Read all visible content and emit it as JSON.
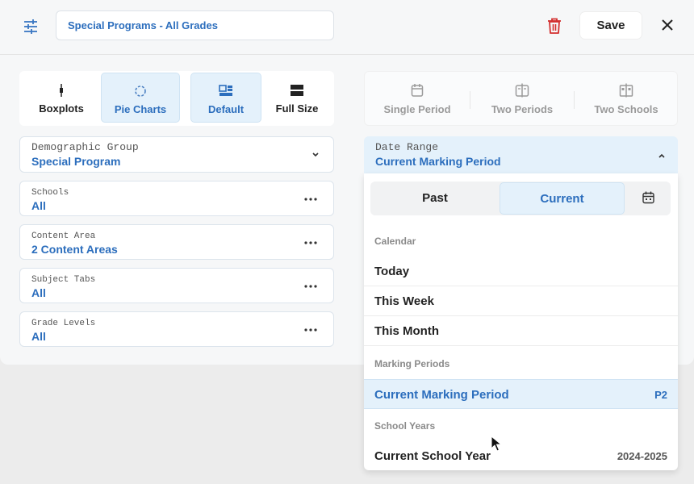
{
  "header": {
    "title_value": "Special Programs - All Grades",
    "save_label": "Save"
  },
  "viz_types": {
    "items": [
      {
        "label": "Boxplots",
        "icon": "boxplot-icon"
      },
      {
        "label": "Pie Charts",
        "icon": "pie-chart-icon"
      }
    ]
  },
  "layout_types": {
    "items": [
      {
        "label": "Default",
        "icon": "default-layout-icon"
      },
      {
        "label": "Full Size",
        "icon": "full-size-icon"
      }
    ]
  },
  "period_types": {
    "items": [
      {
        "label": "Single Period",
        "icon": "calendar-icon"
      },
      {
        "label": "Two Periods",
        "icon": "split-calendar-icon"
      },
      {
        "label": "Two Schools",
        "icon": "split-school-icon"
      }
    ]
  },
  "fields": {
    "demographic": {
      "label": "Demographic Group",
      "value": "Special Program"
    },
    "schools": {
      "label": "Schools",
      "value": "All"
    },
    "content_area": {
      "label": "Content Area",
      "value": "2 Content Areas"
    },
    "subject_tabs": {
      "label": "Subject Tabs",
      "value": "All"
    },
    "grade_levels": {
      "label": "Grade Levels",
      "value": "All"
    }
  },
  "date_range": {
    "label": "Date Range",
    "value": "Current Marking Period",
    "tabs": {
      "past": "Past",
      "current": "Current"
    },
    "calendar_heading": "Calendar",
    "calendar_options": [
      "Today",
      "This Week",
      "This Month"
    ],
    "marking_heading": "Marking Periods",
    "marking_option": {
      "label": "Current Marking Period",
      "tag": "P2"
    },
    "years_heading": "School Years",
    "year_option": {
      "label": "Current School Year",
      "tag": "2024-2025"
    }
  },
  "colors": {
    "accent": "#2c6ebd",
    "selected_bg": "#e4f1fb",
    "danger": "#d32f2f"
  }
}
